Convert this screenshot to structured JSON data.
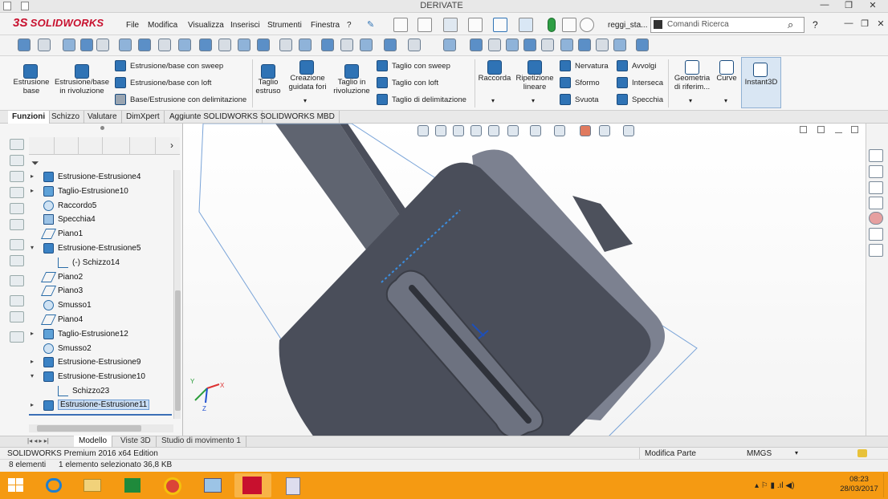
{
  "window": {
    "title": "DERIVATE",
    "controls": [
      "—",
      "❐",
      "✕"
    ]
  },
  "app": {
    "logo": "SOLIDWORKS",
    "menus": [
      "File",
      "Modifica",
      "Visualizza",
      "Inserisci",
      "Strumenti",
      "Finestra",
      "?"
    ],
    "doc_name": "reggi_sta...",
    "search_placeholder": "Comandi Ricerca",
    "help": "?"
  },
  "ribbon": {
    "big": [
      {
        "label": "Estrusione\nbase",
        "icon": "extrude-boss-icon"
      },
      {
        "label": "Estrusione/base\nin rivoluzione",
        "icon": "revolve-boss-icon"
      },
      {
        "label": "Taglio\nestruso",
        "icon": "extruded-cut-icon"
      },
      {
        "label": "Creazione\nguidata fori",
        "icon": "hole-wizard-icon"
      },
      {
        "label": "Taglio in\nrivoluzione",
        "icon": "revolved-cut-icon"
      },
      {
        "label": "Raccorda",
        "icon": "fillet-icon"
      },
      {
        "label": "Ripetizione\nlineare",
        "icon": "linear-pattern-icon"
      },
      {
        "label": "Geometria\ndi riferim...",
        "icon": "reference-geometry-icon"
      },
      {
        "label": "Curve",
        "icon": "curves-icon"
      },
      {
        "label": "Instant3D",
        "icon": "instant3d-icon"
      }
    ],
    "small_boss": [
      "Estrusione/base con sweep",
      "Estrusione/base con loft",
      "Base/Estrusione con delimitazione"
    ],
    "small_cut": [
      "Taglio con sweep",
      "Taglio con loft",
      "Taglio di delimitazione"
    ],
    "small_misc_a": [
      "Nervatura",
      "Sformo",
      "Svuota"
    ],
    "small_misc_b": [
      "Avvolgi",
      "Interseca",
      "Specchia"
    ]
  },
  "tabs": [
    "Funzioni",
    "Schizzo",
    "Valutare",
    "DimXpert",
    "Aggiunte SOLIDWORKS",
    "SOLIDWORKS MBD"
  ],
  "tree": [
    {
      "label": "Estrusione-Estrusione4",
      "icon": "ext",
      "arrow": "▸",
      "indent": 0
    },
    {
      "label": "Taglio-Estrusione10",
      "icon": "cut",
      "arrow": "▸",
      "indent": 0
    },
    {
      "label": "Raccordo5",
      "icon": "fil",
      "arrow": "",
      "indent": 0
    },
    {
      "label": "Specchia4",
      "icon": "mir",
      "arrow": "",
      "indent": 0
    },
    {
      "label": "Piano1",
      "icon": "plane",
      "arrow": "",
      "indent": 0
    },
    {
      "label": "Estrusione-Estrusione5",
      "icon": "ext",
      "arrow": "▾",
      "indent": 0
    },
    {
      "label": "(-) Schizzo14",
      "icon": "sk",
      "arrow": "",
      "indent": 1
    },
    {
      "label": "Piano2",
      "icon": "plane",
      "arrow": "",
      "indent": 0
    },
    {
      "label": "Piano3",
      "icon": "plane",
      "arrow": "",
      "indent": 0
    },
    {
      "label": "Smusso1",
      "icon": "fil",
      "arrow": "",
      "indent": 0
    },
    {
      "label": "Piano4",
      "icon": "plane",
      "arrow": "",
      "indent": 0
    },
    {
      "label": "Taglio-Estrusione12",
      "icon": "cut",
      "arrow": "▸",
      "indent": 0
    },
    {
      "label": "Smusso2",
      "icon": "fil",
      "arrow": "",
      "indent": 0
    },
    {
      "label": "Estrusione-Estrusione9",
      "icon": "ext",
      "arrow": "▸",
      "indent": 0
    },
    {
      "label": "Estrusione-Estrusione10",
      "icon": "ext",
      "arrow": "▾",
      "indent": 0
    },
    {
      "label": "Schizzo23",
      "icon": "sk",
      "arrow": "",
      "indent": 1
    },
    {
      "label": "Estrusione-Estrusione11",
      "icon": "ext",
      "arrow": "▸",
      "indent": 0,
      "selected": true
    }
  ],
  "bottom_tabs": [
    "Modello",
    "Viste 3D",
    "Studio di movimento 1"
  ],
  "status": {
    "edition": "SOLIDWORKS Premium 2016 x64 Edition",
    "mode": "Modifica Parte",
    "units": "MMGS",
    "elements": "8 elementi",
    "selection": "1 elemento selezionato  36,8 KB"
  },
  "taskbar": {
    "time": "08:23",
    "date": "28/03/2017"
  },
  "colors": {
    "part_face": "#4a4e5a",
    "part_side": "#6b707c",
    "taskbar": "#f59a12",
    "selection_blue": "#3b82c4"
  }
}
